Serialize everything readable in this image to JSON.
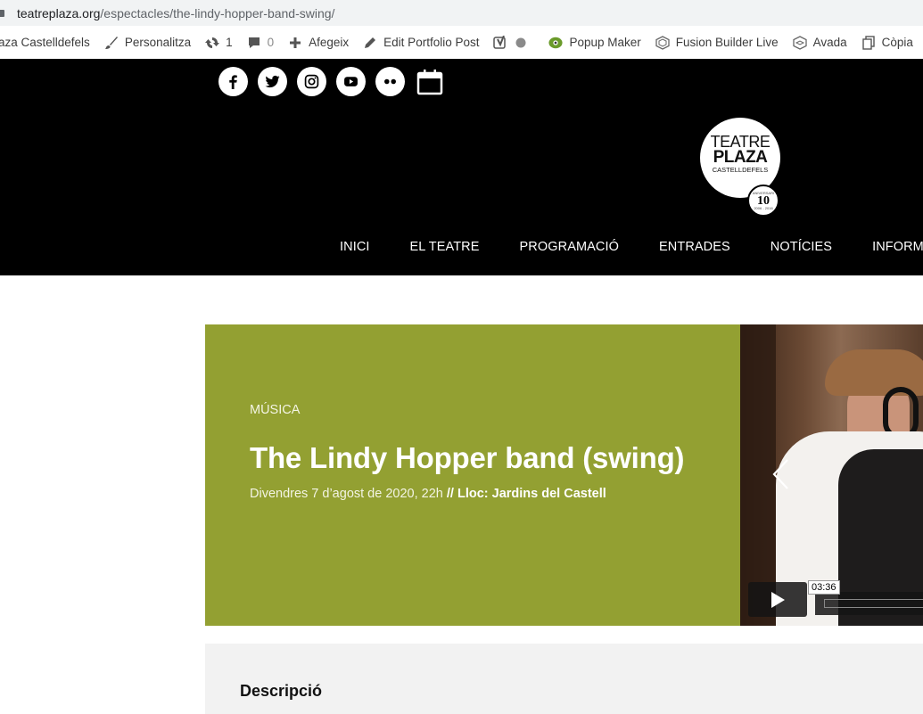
{
  "browser": {
    "url_domain": "teatreplaza.org",
    "url_path": "/espectacles/the-lindy-hopper-band-swing/"
  },
  "admin_bar": {
    "site_name": "aza Castelldefels",
    "customize": "Personalitza",
    "updates_count": "1",
    "comments_count": "0",
    "add_new": "Afegeix",
    "edit_post": "Edit Portfolio Post",
    "popup_maker": "Popup Maker",
    "fusion_builder": "Fusion Builder Live",
    "avada": "Avada",
    "copy": "Còpia"
  },
  "header": {
    "social_icons": [
      "facebook-icon",
      "twitter-icon",
      "instagram-icon",
      "youtube-icon",
      "flickr-icon",
      "calendar-icon"
    ],
    "logo": {
      "line1": "TEATRE",
      "line2": "PLAZA",
      "line3": "CASTELLDEFELS",
      "badge_top": "ANIVERSARI",
      "badge_number": "10",
      "badge_years": "2006 - 2016"
    },
    "nav": [
      "INICI",
      "EL TEATRE",
      "PROGRAMACIÓ",
      "ENTRADES",
      "NOTÍCIES",
      "INFORMACI"
    ]
  },
  "hero": {
    "category": "MÚSICA",
    "title": "The Lindy Hopper band (swing)",
    "date": "Divendres 7 d’agost de 2020, 22h",
    "separator": " // ",
    "venue": "Lloc: Jardins del Castell",
    "background_color": "#93a032"
  },
  "video": {
    "duration": "03:36"
  },
  "description": {
    "heading": "Descripció"
  }
}
